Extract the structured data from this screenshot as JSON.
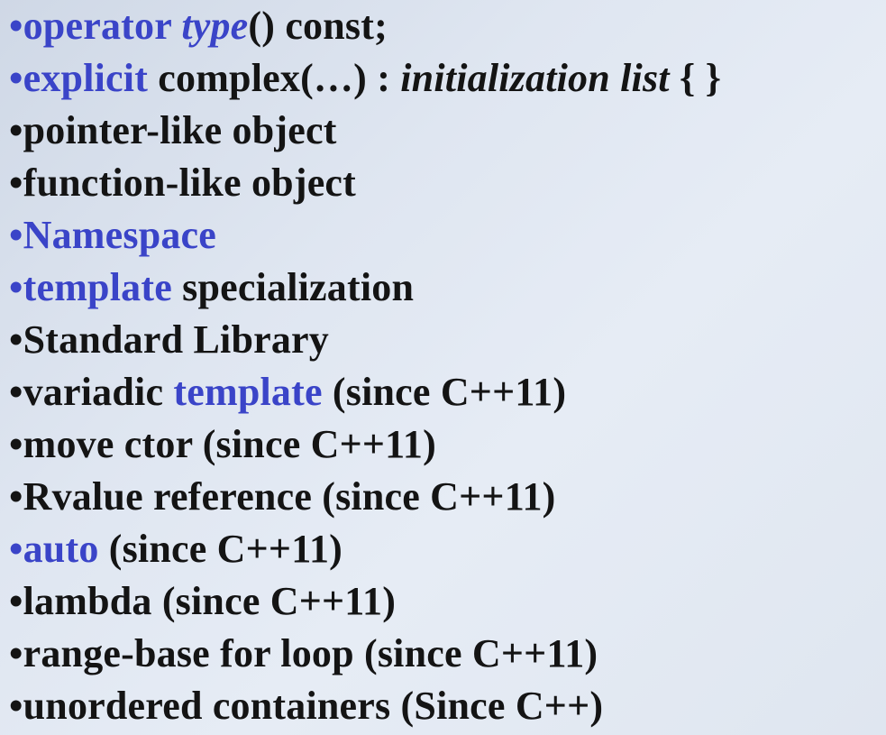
{
  "colors": {
    "keyword_blue": "#3a44c8",
    "text_black": "#141414",
    "background": "#dfe6f1"
  },
  "bullets": [
    {
      "bullet_color": "blue",
      "segments": [
        {
          "text": "operator ",
          "color": "blue",
          "italic": false
        },
        {
          "text": "type",
          "color": "blue",
          "italic": true
        },
        {
          "text": "() const;",
          "color": "black",
          "italic": false
        }
      ]
    },
    {
      "bullet_color": "blue",
      "segments": [
        {
          "text": "explicit",
          "color": "blue",
          "italic": false
        },
        {
          "text": " complex(…) : ",
          "color": "black",
          "italic": false
        },
        {
          "text": "initialization list",
          "color": "black",
          "italic": true
        },
        {
          "text": " {  }",
          "color": "black",
          "italic": false
        }
      ]
    },
    {
      "bullet_color": "black",
      "segments": [
        {
          "text": "pointer-like object",
          "color": "black",
          "italic": false
        }
      ]
    },
    {
      "bullet_color": "black",
      "segments": [
        {
          "text": "function-like object",
          "color": "black",
          "italic": false
        }
      ]
    },
    {
      "bullet_color": "blue",
      "segments": [
        {
          "text": "Namespace",
          "color": "blue",
          "italic": false
        }
      ]
    },
    {
      "bullet_color": "blue",
      "segments": [
        {
          "text": "template",
          "color": "blue",
          "italic": false
        },
        {
          "text": " specialization",
          "color": "black",
          "italic": false
        }
      ]
    },
    {
      "bullet_color": "black",
      "segments": [
        {
          "text": "Standard Library",
          "color": "black",
          "italic": false
        }
      ]
    },
    {
      "bullet_color": "black",
      "segments": [
        {
          "text": "variadic ",
          "color": "black",
          "italic": false
        },
        {
          "text": "template",
          "color": "blue",
          "italic": false
        },
        {
          "text": " (since C++11)",
          "color": "black",
          "italic": false
        }
      ]
    },
    {
      "bullet_color": "black",
      "segments": [
        {
          "text": "move ctor (since C++11)",
          "color": "black",
          "italic": false
        }
      ]
    },
    {
      "bullet_color": "black",
      "segments": [
        {
          "text": "Rvalue reference (since C++11)",
          "color": "black",
          "italic": false
        }
      ]
    },
    {
      "bullet_color": "blue",
      "segments": [
        {
          "text": "auto",
          "color": "blue",
          "italic": false
        },
        {
          "text": " (since C++11)",
          "color": "black",
          "italic": false
        }
      ]
    },
    {
      "bullet_color": "black",
      "segments": [
        {
          "text": "lambda (since C++11)",
          "color": "black",
          "italic": false
        }
      ]
    },
    {
      "bullet_color": "black",
      "segments": [
        {
          "text": "range-base for loop (since C++11)",
          "color": "black",
          "italic": false
        }
      ]
    },
    {
      "bullet_color": "black",
      "segments": [
        {
          "text": "unordered containers (Since C++)",
          "color": "black",
          "italic": false
        }
      ]
    }
  ]
}
